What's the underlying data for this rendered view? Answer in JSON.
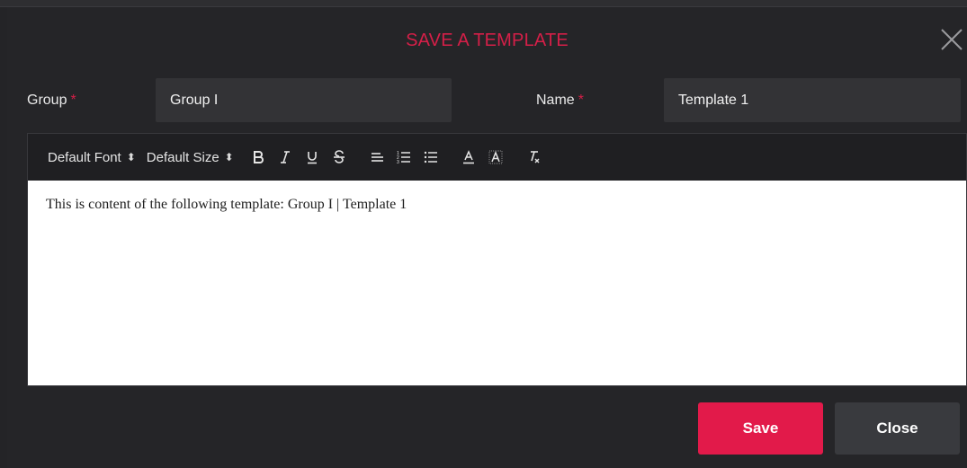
{
  "dialog": {
    "title": "SAVE A TEMPLATE",
    "close_icon": "close-icon"
  },
  "form": {
    "group_label": "Group",
    "group_required": "*",
    "group_value": "Group I",
    "name_label": "Name",
    "name_required": "*",
    "name_value": "Template 1"
  },
  "toolbar": {
    "font_select": "Default Font",
    "size_select": "Default Size",
    "buttons": [
      "bold-icon",
      "italic-icon",
      "underline-icon",
      "strikethrough-icon",
      "align-icon",
      "ordered-list-icon",
      "bullet-list-icon",
      "text-color-icon",
      "background-color-icon",
      "clear-formatting-icon"
    ]
  },
  "editor": {
    "content": "This is content of the following template: Group I | Template 1"
  },
  "actions": {
    "save_label": "Save",
    "close_label": "Close"
  },
  "colors": {
    "accent": "#e21a4a",
    "title": "#d51f48",
    "background": "#252528",
    "field": "#333336"
  }
}
